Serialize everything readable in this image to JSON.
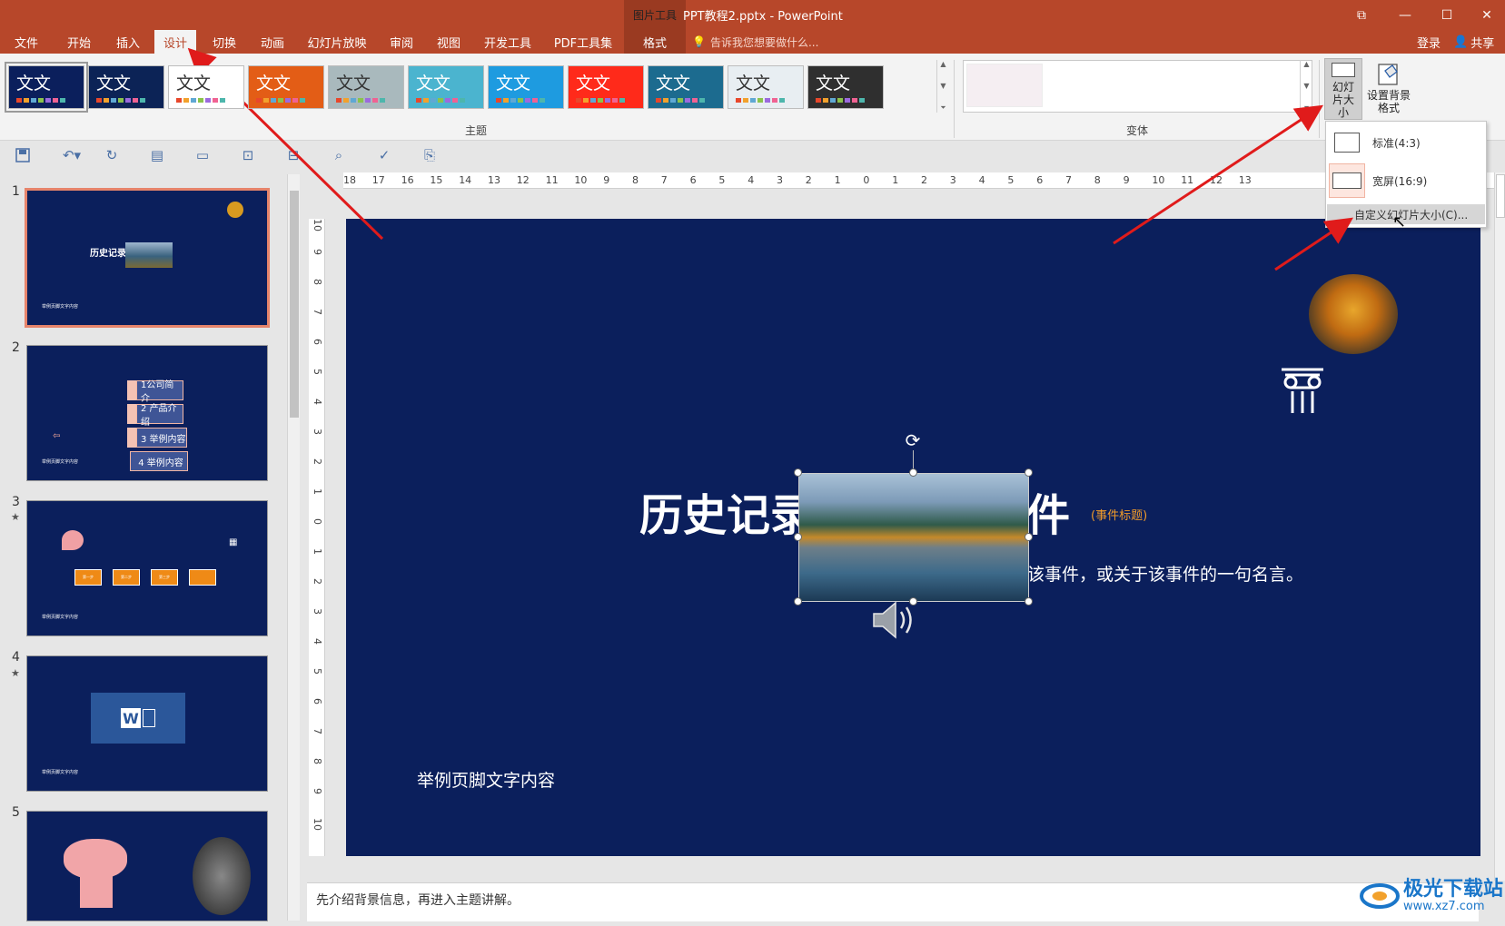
{
  "window": {
    "context_tools": "图片工具",
    "title": "PPT教程2.pptx - PowerPoint",
    "controls": [
      "⧉",
      "—",
      "☐",
      "✕"
    ]
  },
  "tabs": [
    {
      "label": "文件"
    },
    {
      "label": "开始"
    },
    {
      "label": "插入"
    },
    {
      "label": "设计",
      "active": true
    },
    {
      "label": "切换"
    },
    {
      "label": "动画"
    },
    {
      "label": "幻灯片放映"
    },
    {
      "label": "审阅"
    },
    {
      "label": "视图"
    },
    {
      "label": "开发工具"
    },
    {
      "label": "PDF工具集"
    },
    {
      "label": "格式"
    }
  ],
  "tell_me": "告诉我您想要做什么...",
  "account": {
    "login": "登录",
    "share": "共享"
  },
  "ribbon": {
    "themes_group_label": "主题",
    "variants_group_label": "变体",
    "theme_text": "文文",
    "themes": [
      {
        "bg": "#0b1f5c",
        "fg": "#ffffff",
        "selected": true
      },
      {
        "bg": "#0c2356",
        "fg": "#ffffff"
      },
      {
        "bg": "#ffffff",
        "fg": "#333333"
      },
      {
        "bg": "#e35d16",
        "fg": "#ffffff"
      },
      {
        "bg": "#a9b9bd",
        "fg": "#333333"
      },
      {
        "bg": "#4bb4cf",
        "fg": "#ffffff"
      },
      {
        "bg": "#1e9be0",
        "fg": "#ffffff"
      },
      {
        "bg": "#ff2a1a",
        "fg": "#ffffff"
      },
      {
        "bg": "#1c6b8f",
        "fg": "#ffffff"
      },
      {
        "bg": "#e8eef2",
        "fg": "#333333"
      },
      {
        "bg": "#2f2f2f",
        "fg": "#ffffff"
      }
    ],
    "slide_size_button": "幻灯片大小",
    "bg_format_button": "设置背景格式"
  },
  "slide_size_menu": {
    "standard": "标准(4:3)",
    "widescreen": "宽屏(16:9)",
    "custom": "自定义幻灯片大小(C)..."
  },
  "thumbnails": [
    {
      "number": "1",
      "footer": "举例页脚文字内容",
      "title": "历史记录件"
    },
    {
      "number": "2",
      "footer": "举例页脚文字内容",
      "items": [
        "1公司简介",
        "2 产品介绍",
        "3 举例内容",
        "4 举例内容"
      ]
    },
    {
      "number": "3",
      "star": "★",
      "footer": "举例页脚文字内容",
      "steps": [
        "第一步",
        "第二步",
        "第三步",
        ""
      ]
    },
    {
      "number": "4",
      "star": "★",
      "footer": "举例页脚文字内容"
    },
    {
      "number": "5"
    }
  ],
  "ruler": {
    "horizontal": [
      "18",
      "17",
      "16",
      "15",
      "14",
      "13",
      "12",
      "11",
      "10",
      "9",
      "8",
      "7",
      "6",
      "5",
      "4",
      "3",
      "2",
      "1",
      "0",
      "1",
      "2",
      "3",
      "4",
      "5",
      "6",
      "7",
      "8",
      "9",
      "10",
      "11",
      "12",
      "13"
    ],
    "vertical": [
      "10",
      "9",
      "8",
      "7",
      "6",
      "5",
      "4",
      "3",
      "2",
      "1",
      "0",
      "1",
      "2",
      "3",
      "4",
      "5",
      "6",
      "7",
      "8",
      "9",
      "10"
    ]
  },
  "slide": {
    "title_left": "历史记录",
    "title_right": "件",
    "title_tag": "(事件标题)",
    "subtitle": "该事件，或关于该事件的一句名言。",
    "footer": "举例页脚文字内容"
  },
  "notes": "先介绍背景信息，再进入主题讲解。",
  "watermark": {
    "text": "极光下载站",
    "url": "www.xz7.com"
  }
}
